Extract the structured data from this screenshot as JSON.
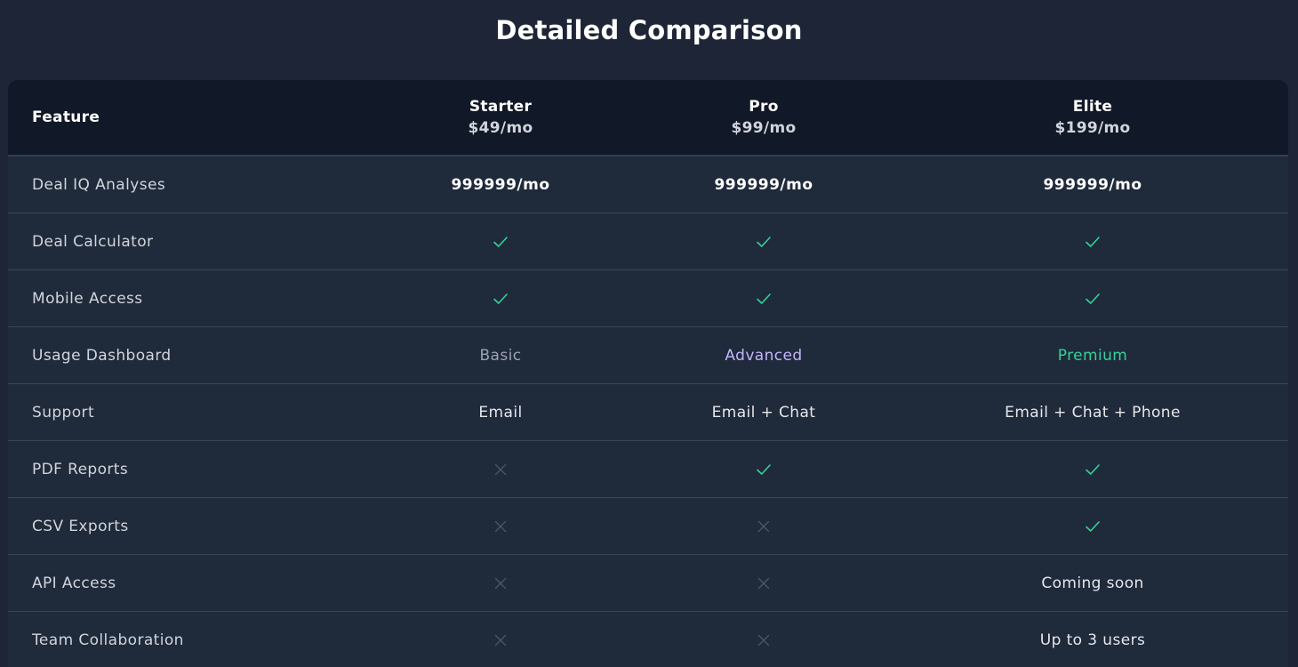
{
  "page": {
    "title": "Detailed Comparison"
  },
  "table": {
    "feature_header": "Feature",
    "plans": [
      {
        "name": "Starter",
        "price": "$49/mo"
      },
      {
        "name": "Pro",
        "price": "$99/mo"
      },
      {
        "name": "Elite",
        "price": "$199/mo"
      }
    ],
    "rows": [
      {
        "feature": "Deal IQ Analyses",
        "values": [
          "999999/mo",
          "999999/mo",
          "999999/mo"
        ]
      },
      {
        "feature": "Deal Calculator",
        "values": [
          "check-icon",
          "check-icon",
          "check-icon"
        ]
      },
      {
        "feature": "Mobile Access",
        "values": [
          "check-icon",
          "check-icon",
          "check-icon"
        ]
      },
      {
        "feature": "Usage Dashboard",
        "values": [
          "Basic",
          "Advanced",
          "Premium"
        ]
      },
      {
        "feature": "Support",
        "values": [
          "Email",
          "Email + Chat",
          "Email + Chat + Phone"
        ]
      },
      {
        "feature": "PDF Reports",
        "values": [
          "x-icon",
          "check-icon",
          "check-icon"
        ]
      },
      {
        "feature": "CSV Exports",
        "values": [
          "x-icon",
          "x-icon",
          "check-icon"
        ]
      },
      {
        "feature": "API Access",
        "values": [
          "x-icon",
          "x-icon",
          "Coming soon"
        ]
      },
      {
        "feature": "Team Collaboration",
        "values": [
          "x-icon",
          "x-icon",
          "Up to 3 users"
        ]
      }
    ]
  },
  "colors": {
    "background": "#1e2537",
    "header_background": "#111827",
    "row_background": "#1f2a3b",
    "check": "#34d399",
    "x_mark": "#4b5563",
    "advanced": "#c4b5fd",
    "premium": "#34d399"
  }
}
